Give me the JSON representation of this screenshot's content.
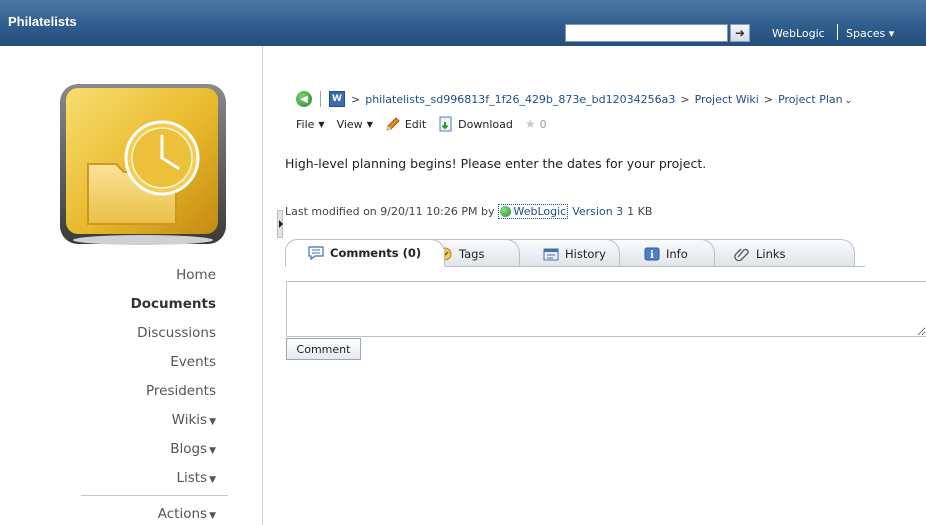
{
  "header": {
    "app_title": "Philatelists",
    "search": {
      "value": "",
      "placeholder": ""
    },
    "user_link": "WebLogic",
    "spaces_menu": "Spaces ▾"
  },
  "sidebar": {
    "nav": [
      {
        "label": "Home",
        "active": false
      },
      {
        "label": "Documents",
        "active": true
      },
      {
        "label": "Discussions",
        "active": false
      },
      {
        "label": "Events",
        "active": false
      },
      {
        "label": "Presidents",
        "active": false
      },
      {
        "label": "Wikis",
        "active": false,
        "menu": true
      },
      {
        "label": "Blogs",
        "active": false,
        "menu": true
      },
      {
        "label": "Lists",
        "active": false,
        "menu": true
      },
      {
        "label": "Actions",
        "active": false,
        "menu": true
      }
    ]
  },
  "breadcrumb": {
    "items": [
      "philatelists_sd996813f_1f26_429b_873e_bd12034256a3",
      "Project Wiki",
      "Project Plan"
    ],
    "separator": ">"
  },
  "toolbar": {
    "file": "File",
    "view": "View",
    "edit": "Edit",
    "download": "Download",
    "rating": "0"
  },
  "document": {
    "description": "High-level planning begins!  Please enter the dates for your project."
  },
  "meta": {
    "prefix": "Last modified on 9/20/11 10:26 PM by",
    "user": "WebLogic",
    "version": "Version 3",
    "size": "1 KB"
  },
  "tabs": [
    {
      "label": "Comments (0)",
      "icon": "comment-icon",
      "active": true
    },
    {
      "label": "Tags",
      "icon": "tag-icon",
      "active": false
    },
    {
      "label": "History",
      "icon": "history-icon",
      "active": false
    },
    {
      "label": "Info",
      "icon": "info-icon",
      "active": false
    },
    {
      "label": "Links",
      "icon": "link-icon",
      "active": false
    }
  ],
  "comments": {
    "value": "",
    "button_label": "Comment"
  },
  "colors": {
    "header_bg": "#2f5d8d",
    "link": "#1b4f86",
    "presence_online": "#1f8f28"
  }
}
